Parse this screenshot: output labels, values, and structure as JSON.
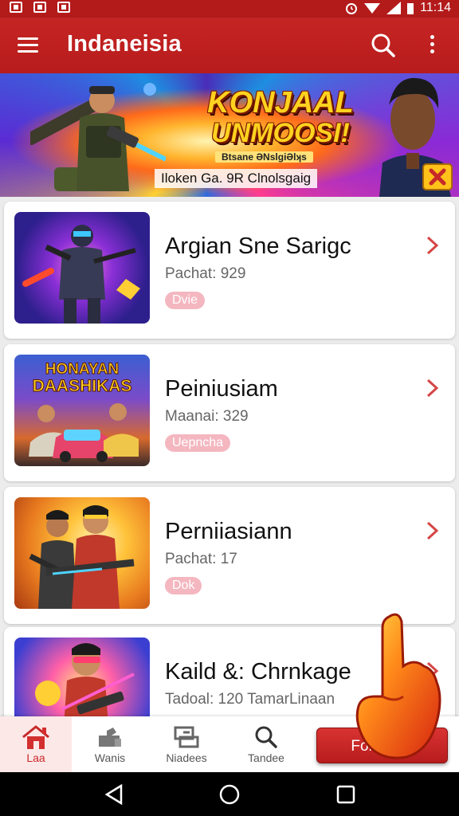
{
  "status_bar": {
    "time": "11:14",
    "icons": [
      "notification-box-icon",
      "notification-box-icon",
      "notification-box-icon",
      "alarm-icon",
      "wifi-icon",
      "signal-icon",
      "battery-icon"
    ]
  },
  "app_bar": {
    "title": "Indaneisia",
    "icons": [
      "menu-icon",
      "search-icon",
      "more-vert-icon"
    ]
  },
  "banner": {
    "title_line1": "KONJAAL",
    "title_line2": "UNMOOSI!",
    "subtitle": "Btsane ƏNslgiƏlʞs",
    "caption": "Iloken Ga. 9R Clnolsgaig"
  },
  "items": [
    {
      "title": "Argian Sne Sarigc",
      "meta": "Pachat: 929",
      "tag": "Dvie",
      "thumb": "soldier"
    },
    {
      "title": "Peiniusiam",
      "meta": "Maanai: 329",
      "tag": "Uepncha",
      "thumb": "cars",
      "thumb_line1": "HONAYAN",
      "thumb_line2": "DAASHIKAS"
    },
    {
      "title": "Perniiasiann",
      "meta": "Pachat:  17",
      "tag": "Dok",
      "thumb": "gunners"
    },
    {
      "title": "Kaild &: Chrnkage",
      "meta": "Tadoal: 120 TamarLinaan",
      "tag": "",
      "thumb": "hero"
    }
  ],
  "bottom_nav": [
    {
      "label": "Laa",
      "icon": "home-icon",
      "active": true
    },
    {
      "label": "Wanis",
      "icon": "gamepad-icon",
      "active": false
    },
    {
      "label": "Niadees",
      "icon": "swap-icon",
      "active": false
    },
    {
      "label": "Tandee",
      "icon": "search-icon",
      "active": false
    }
  ],
  "fab": {
    "label": "Fompesk"
  },
  "colors": {
    "primary": "#c62828",
    "tag": "#f4b7c0",
    "background": "#ececec"
  }
}
